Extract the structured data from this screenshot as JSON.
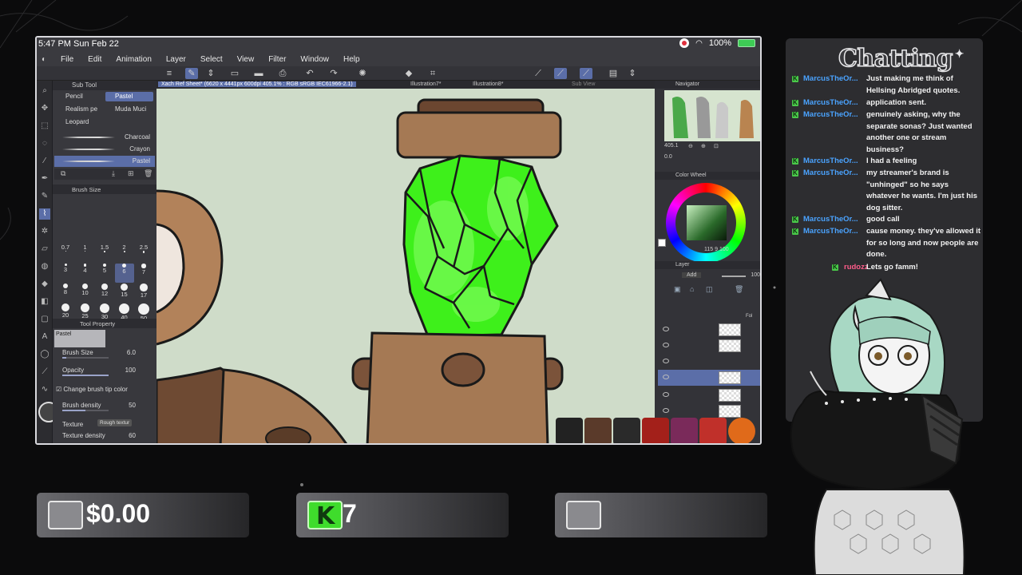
{
  "status_bar": {
    "time": "5:47 PM  Sun Feb 22",
    "battery": "100%"
  },
  "menu": [
    "File",
    "Edit",
    "Animation",
    "Layer",
    "Select",
    "View",
    "Filter",
    "Window",
    "Help"
  ],
  "doc_tabs": {
    "active": "Xach Ref Sheet* (6620 x 4441px 600dpi 405.1% : RGB sRGB IEC61966-2.1)",
    "tab2": "Illustration7*",
    "tab3": "Illustration8*",
    "sub_view": "Sub View"
  },
  "sub_tool": {
    "title": "Sub Tool",
    "tabs": [
      "Pencil",
      "Pastel",
      "Realism pe",
      "Muda Muci",
      "Leopard"
    ],
    "brushes": [
      "Charcoal",
      "Crayon",
      "Pastel"
    ],
    "brush_size_title": "Brush Size",
    "sizes": [
      "0.7",
      "1",
      "1.5",
      "2",
      "2.5",
      "3",
      "4",
      "5",
      "6",
      "7",
      "8",
      "10",
      "12",
      "15",
      "17",
      "20",
      "25",
      "30",
      "40",
      "50"
    ],
    "tool_property_title": "Tool Property",
    "preset_name": "Pastel",
    "brush_size_label": "Brush Size",
    "brush_size_value": "6.0",
    "opacity_label": "Opacity",
    "opacity_value": "100",
    "change_tip_label": "Change brush tip color",
    "brush_density_label": "Brush density",
    "brush_density_value": "50",
    "texture_label": "Texture",
    "texture_value": "Rough textur",
    "texture_density_label": "Texture density",
    "texture_density_value": "60"
  },
  "navigator": {
    "title": "Navigator",
    "zoom": "405.1",
    "rotate": "0.0"
  },
  "color_wheel": {
    "title": "Color Wheel",
    "values": "115  9  100"
  },
  "layer": {
    "title": "Layer",
    "blend": "Add",
    "opacity": "100",
    "folder_label": "Fol"
  },
  "chat": {
    "title": "Chatting",
    "messages": [
      {
        "user": "MarcusTheOr...",
        "text": "Just making me think of Hellsing Abridged quotes."
      },
      {
        "user": "MarcusTheOr...",
        "text": "application sent."
      },
      {
        "user": "MarcusTheOr...",
        "text": "genuinely asking, why the separate sonas? Just wanted another one or stream business?"
      },
      {
        "user": "MarcusTheOr...",
        "text": "I had a feeling"
      },
      {
        "user": "MarcusTheOr...",
        "text": "my streamer's brand is \"unhinged\" so he says whatever he wants. I'm just his dog sitter."
      },
      {
        "user": "MarcusTheOr...",
        "text": "good call"
      },
      {
        "user": "MarcusTheOr...",
        "text": "cause money. they've allowed it for so long and now people are done."
      },
      {
        "user": "rudozz",
        "text": "Lets go famm!"
      }
    ],
    "colors": {
      "user_blue": "#4aa3ff",
      "user_pink": "#ff5c8a",
      "kick_green": "#4ac94a"
    }
  },
  "stats": {
    "donations": "$0.00",
    "kick_followers": "7",
    "kick_letter": "K"
  }
}
